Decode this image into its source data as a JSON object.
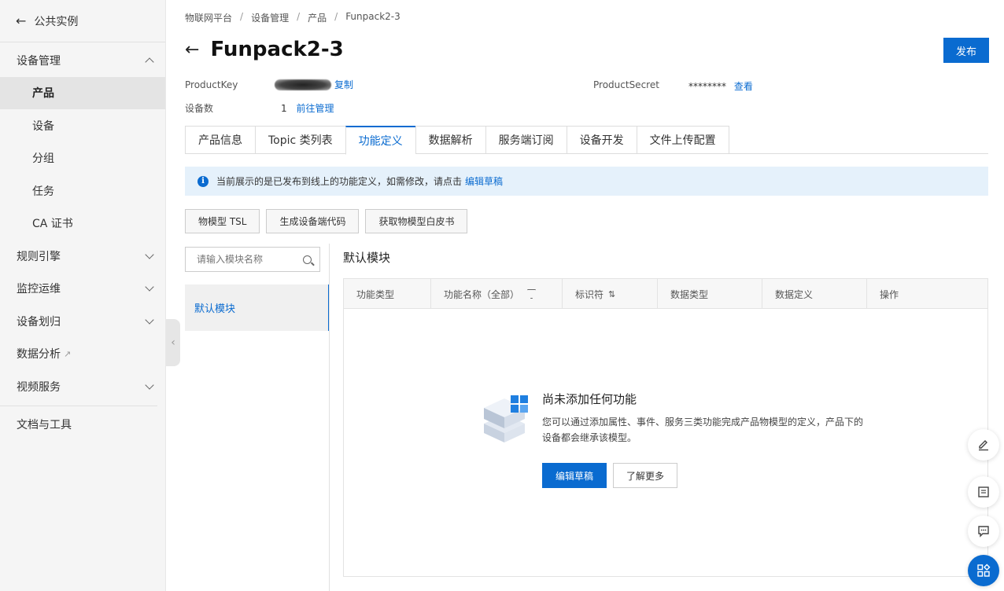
{
  "sidebar": {
    "back_label": "公共实例",
    "device_mgmt": "设备管理",
    "sub_items": [
      "产品",
      "设备",
      "分组",
      "任务",
      "CA 证书"
    ],
    "rule_engine": "规则引擎",
    "monitor_ops": "监控运维",
    "device_assign": "设备划归",
    "data_analysis": "数据分析",
    "video_service": "视频服务",
    "docs_tools": "文档与工具"
  },
  "breadcrumb": [
    "物联网平台",
    "设备管理",
    "产品",
    "Funpack2-3"
  ],
  "header": {
    "title": "Funpack2-3",
    "publish_label": "发布"
  },
  "meta": {
    "product_key_label": "ProductKey",
    "product_key_value": "a1",
    "copy_label": "复制",
    "product_secret_label": "ProductSecret",
    "product_secret_value": "********",
    "view_label": "查看",
    "device_count_label": "设备数",
    "device_count_value": "1",
    "manage_label": "前往管理"
  },
  "tabs": [
    "产品信息",
    "Topic 类列表",
    "功能定义",
    "数据解析",
    "服务端订阅",
    "设备开发",
    "文件上传配置"
  ],
  "notice": {
    "text": "当前展示的是已发布到线上的功能定义，如需修改，请点击",
    "link": "编辑草稿"
  },
  "toolbar": [
    "物模型 TSL",
    "生成设备端代码",
    "获取物模型白皮书"
  ],
  "module": {
    "search_placeholder": "请输入模块名称",
    "list_item": "默认模块",
    "section_title": "默认模块"
  },
  "table": {
    "headers": [
      "功能类型",
      "功能名称（全部）",
      "标识符",
      "数据类型",
      "数据定义",
      "操作"
    ]
  },
  "empty": {
    "title": "尚未添加任何功能",
    "desc": "您可以通过添加属性、事件、服务三类功能完成产品物模型的定义，产品下的设备都会继承该模型。",
    "primary_label": "编辑草稿",
    "secondary_label": "了解更多"
  },
  "colors": {
    "accent": "#0a6bd0",
    "notice_bg": "#e5f1fb"
  }
}
